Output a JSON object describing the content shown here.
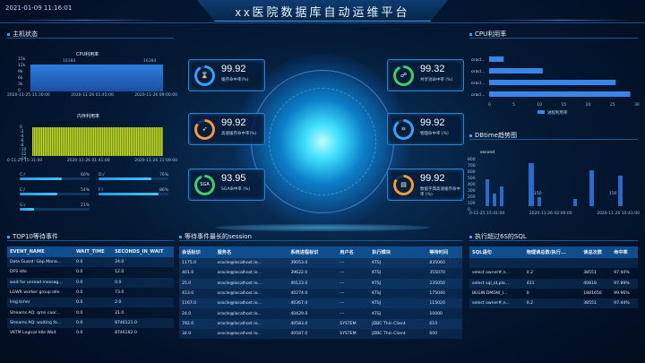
{
  "header": {
    "datetime": "2021-01-09 11:16:01",
    "title": "xx医院数据库自动运维平台"
  },
  "host_status": {
    "title": "主机状态",
    "cpu_chart": {
      "title": "CPU利用率",
      "y_ticks": [
        "15k",
        "12k",
        "9k",
        "6k",
        "3k",
        "0"
      ],
      "peak_labels": [
        "16384",
        "16384"
      ],
      "x_labels": [
        "2020-11-25 15:30:00",
        "2020-11-26 01:45:00",
        "2020-11-26 09:00:00"
      ]
    },
    "mem_chart": {
      "title": "内存利用率",
      "y_ticks": [
        "0",
        "-2",
        "-4",
        "-6",
        "-8",
        "-10",
        "-12",
        "-14",
        "-16"
      ],
      "x_labels": [
        "0-11-25 15:31:00",
        "2020-11-26 01:41:00",
        "2020-11-26 11:09:00"
      ]
    },
    "disks": [
      {
        "name": "C:/",
        "pct": "60%",
        "value": 60
      },
      {
        "name": "D:/",
        "pct": "76%",
        "value": 76
      },
      {
        "name": "E:/",
        "pct": "54%",
        "value": 54
      },
      {
        "name": "F:/",
        "pct": "86%",
        "value": 86
      },
      {
        "name": "G:/",
        "pct": "21%",
        "value": 21
      }
    ]
  },
  "kpis": [
    {
      "value": "99.92",
      "label": "缓存命中率(%)",
      "icon": "hourglass-icon",
      "glyph": "⌛",
      "color": "#3aa0ff",
      "pct": 0.92
    },
    {
      "value": "99.92",
      "label": "高速缓存命中率(%)",
      "icon": "rocket-icon",
      "glyph": "➶",
      "color": "#f39a3c",
      "pct": 0.85
    },
    {
      "value": "93.95",
      "label": "SGA命中率 (%)",
      "icon": "sga-icon",
      "glyph": "SGA",
      "color": "#3fd06a",
      "pct": 0.94
    },
    {
      "value": "99.32",
      "label": "共享池命中率 (%)",
      "icon": "share-icon",
      "glyph": "☍",
      "color": "#3fd06a",
      "pct": 0.93
    },
    {
      "value": "99.92",
      "label": "物理命中率 (%)",
      "icon": "atom-icon",
      "glyph": "⚛",
      "color": "#3aa0ff",
      "pct": 0.9
    },
    {
      "value": "99.92",
      "label": "数据字典高速缓存命中率 (%)",
      "icon": "doc-icon",
      "glyph": "▤",
      "color": "#f39a3c",
      "pct": 0.85
    }
  ],
  "cpu_usage": {
    "title": "CPU利用率",
    "type": "bar",
    "categories": [
      "oracl...",
      "oracl...",
      "oracl...",
      "oracl..."
    ],
    "values": [
      3,
      11,
      26,
      29
    ],
    "x_ticks": [
      "0",
      "5",
      "10",
      "15",
      "20",
      "25",
      "30"
    ],
    "legend": "进程利用率"
  },
  "dbtime": {
    "title": "DBtime趋势图",
    "series_label": "second",
    "y_ticks": [
      "800",
      "700",
      "600",
      "500",
      "400",
      "300",
      "200",
      "100",
      "0"
    ],
    "x_labels": [
      "0-11-25 15:41:00",
      "2020-11-26 02:00:00",
      "2020-11-26 10:43:00"
    ],
    "annotations": [
      "150",
      "150"
    ]
  },
  "top10": {
    "title": "TOP10等待事件",
    "columns": [
      "EVENT_NAME",
      "WAIT_TIME",
      "SECONDS_IN_WAIT"
    ],
    "rows": [
      [
        "Data Guard: Gap Mana...",
        "0.0",
        "24.0"
      ],
      [
        "DFS idle",
        "0.0",
        "12.0"
      ],
      [
        "wait for unread messag...",
        "0.0",
        "0.0"
      ],
      [
        "LGWR worker group idle",
        "0.0",
        "73.0"
      ],
      [
        "lreg timer",
        "0.0",
        "2.0"
      ],
      [
        "Streams AQ: qmn coor...",
        "0.0",
        "21.0"
      ],
      [
        "Streams AQ: waiting fo...",
        "0.0",
        "8746121.0"
      ],
      [
        "VKTM Logical Idle Wait",
        "0.0",
        "8746182.0"
      ]
    ]
  },
  "longest_wait": {
    "title": "等待事件最长的session",
    "columns": [
      "会话标识",
      "服务名",
      "系统进程标识",
      "用户名",
      "执行模块",
      "等待时间"
    ],
    "rows": [
      [
        "1175.0",
        "oracle@localhost.lo...",
        "39053.0",
        "---",
        "KTSJ",
        "835060"
      ],
      [
        "401.0",
        "oracle@localhost.lo...",
        "39622.0",
        "---",
        "KTSJ",
        "355070"
      ],
      [
        "25.0",
        "oracle@localhost.lo...",
        "40123.0",
        "---",
        "KTSJ",
        "235050"
      ],
      [
        "413.0",
        "oracle@localhost.lo...",
        "40274.0",
        "---",
        "KTSJ",
        "175040"
      ],
      [
        "1167.0",
        "oracle@localhost.lo...",
        "40367.0",
        "---",
        "KTSJ",
        "115020"
      ],
      [
        "24.0",
        "oracle@localhost.lo...",
        "40429.0",
        "---",
        "KTSJ",
        "10000"
      ],
      [
        "792.0",
        "oracle@localhost.lo...",
        "40583.0",
        "SYSTEM",
        "JDBC Thin Client",
        "610"
      ],
      [
        "34.0",
        "oracle@localhost.lo...",
        "40587.0",
        "SYSTEM",
        "JDBC Thin Client",
        "600"
      ]
    ]
  },
  "slow_sql": {
    "title": "执行超过6S的SQL",
    "columns": [
      "SQL语句",
      "物理读总数/执行...",
      "读总次数",
      "命中率"
    ],
    "rows": [
      [
        "",
        "",
        "",
        ""
      ],
      [
        "select owner#,n...",
        "0.2",
        "38551",
        "97.44%"
      ],
      [
        "select sql_id,pla...",
        "431",
        "40818",
        "97.89%"
      ],
      [
        "BEGIN DMDW_I...",
        "0",
        "1881650",
        "99.96%"
      ],
      [
        "select owner#,n...",
        "0.2",
        "38551",
        "97.44%"
      ]
    ]
  }
}
